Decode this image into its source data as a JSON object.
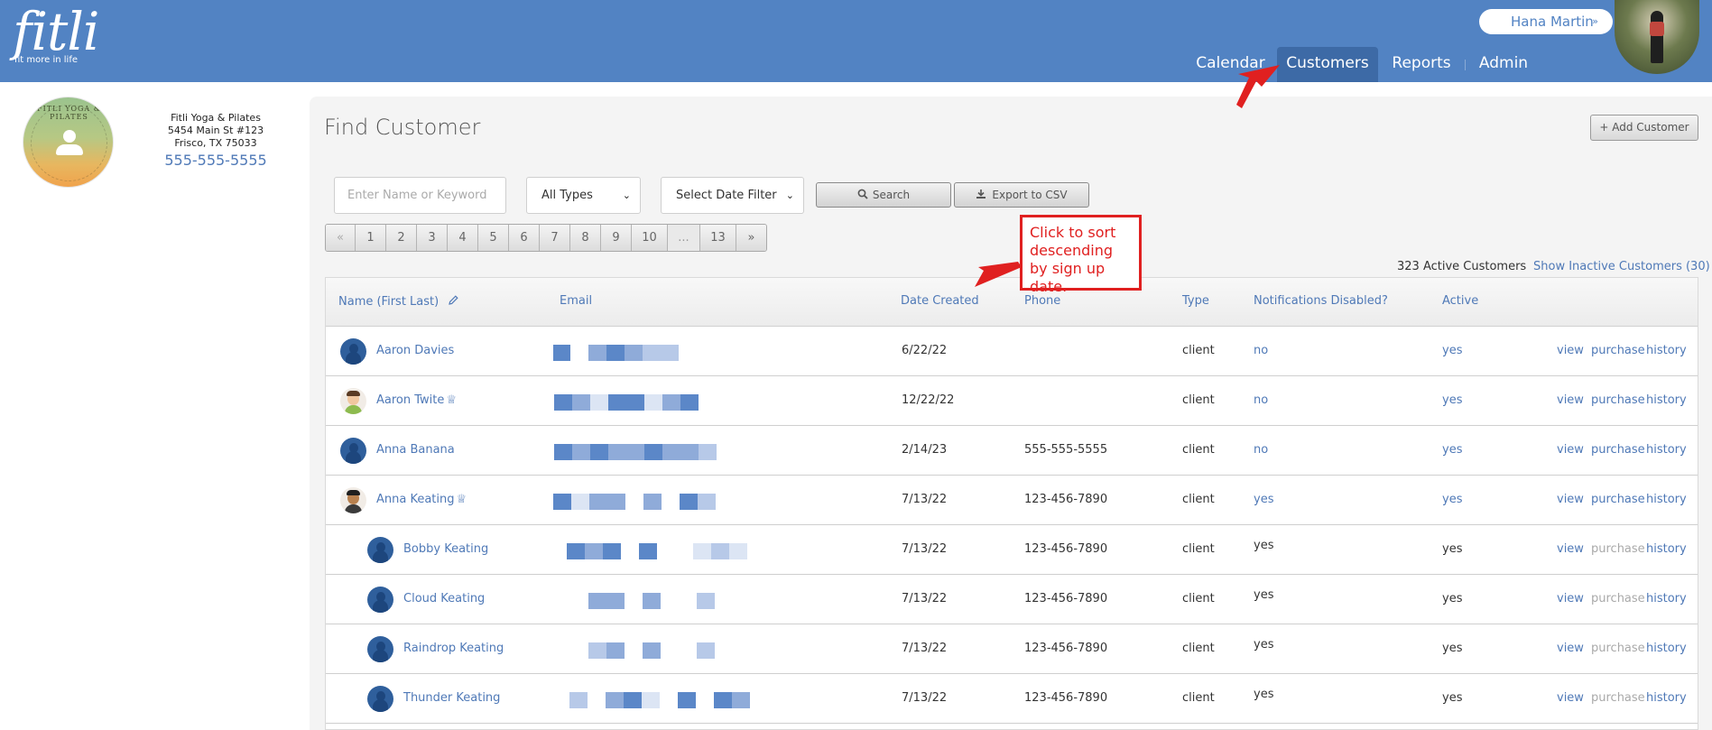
{
  "header": {
    "logo_text": "fitli",
    "logo_tagline": "fit more in life",
    "user_name": "Hana Martin",
    "user_chevron": "»",
    "nav": [
      {
        "label": "Calendar"
      },
      {
        "label": "Customers"
      },
      {
        "label": "Reports"
      },
      {
        "label": "Admin"
      }
    ],
    "active_nav": "Customers"
  },
  "studio": {
    "logo_text": "FITLI YOGA & PILATES",
    "name": "Fitli Yoga & Pilates",
    "address1": "5454 Main St #123",
    "address2": "Frisco, TX 75033",
    "phone": "555-555-5555"
  },
  "page": {
    "title": "Find Customer",
    "add_button": "+ Add Customer"
  },
  "filters": {
    "search_placeholder": "Enter Name or Keyword",
    "type_select": "All Types",
    "date_select": "Select Date Filter",
    "search_button": "Search",
    "export_button": "Export to CSV"
  },
  "pagination": [
    "«",
    "1",
    "2",
    "3",
    "4",
    "5",
    "6",
    "7",
    "8",
    "9",
    "10",
    "...",
    "13",
    "»"
  ],
  "counts": {
    "active": "323 Active Customers",
    "inactive": "Show Inactive Customers (30)"
  },
  "annotation": {
    "text": "Click to sort descending by sign up date."
  },
  "table": {
    "headers": {
      "name": "Name (First Last)",
      "email": "Email",
      "date": "Date Created",
      "phone": "Phone",
      "type": "Type",
      "notifications": "Notifications Disabled?",
      "active": "Active"
    },
    "rows": [
      {
        "name": "Aaron Davies",
        "date": "6/22/22",
        "phone": "",
        "type": "client",
        "notifications": "no",
        "active": "yes",
        "actions": [
          "view",
          "purchase",
          "history"
        ],
        "birthday": false
      },
      {
        "name": "Aaron Twite",
        "date": "12/22/22",
        "phone": "",
        "type": "client",
        "notifications": "no",
        "active": "yes",
        "actions": [
          "view",
          "purchase",
          "history"
        ],
        "birthday": true
      },
      {
        "name": "Anna Banana",
        "date": "2/14/23",
        "phone": "555-555-5555",
        "type": "client",
        "notifications": "no",
        "active": "yes",
        "actions": [
          "view",
          "purchase",
          "history"
        ],
        "birthday": false
      },
      {
        "name": "Anna Keating",
        "date": "7/13/22",
        "phone": "123-456-7890",
        "type": "client",
        "notifications": "yes",
        "active": "yes",
        "actions": [
          "view",
          "purchase",
          "history"
        ],
        "birthday": true
      },
      {
        "name": "Bobby Keating",
        "date": "7/13/22",
        "phone": "123-456-7890",
        "type": "client",
        "notifications": "yes",
        "active": "yes",
        "actions": [
          "view",
          "purchase",
          "history"
        ],
        "birthday": false
      },
      {
        "name": "Cloud Keating",
        "date": "7/13/22",
        "phone": "123-456-7890",
        "type": "client",
        "notifications": "yes",
        "active": "yes",
        "actions": [
          "view",
          "purchase",
          "history"
        ],
        "birthday": false
      },
      {
        "name": "Raindrop Keating",
        "date": "7/13/22",
        "phone": "123-456-7890",
        "type": "client",
        "notifications": "yes",
        "active": "yes",
        "actions": [
          "view",
          "purchase",
          "history"
        ],
        "birthday": false
      },
      {
        "name": "Thunder Keating",
        "date": "7/13/22",
        "phone": "123-456-7890",
        "type": "client",
        "notifications": "yes",
        "active": "yes",
        "actions": [
          "view",
          "purchase",
          "history"
        ],
        "birthday": false
      }
    ]
  },
  "colors": {
    "header_bg": "#5283c3",
    "active_nav_bg": "#3d6aa6",
    "link": "#4f79b7",
    "annotation": "#e02020"
  },
  "icons": [
    "user-avatar-icon",
    "chevron-down-icon",
    "pencil-icon",
    "search-icon",
    "download-icon",
    "birthday-cake-icon",
    "caret-down-icon"
  ]
}
